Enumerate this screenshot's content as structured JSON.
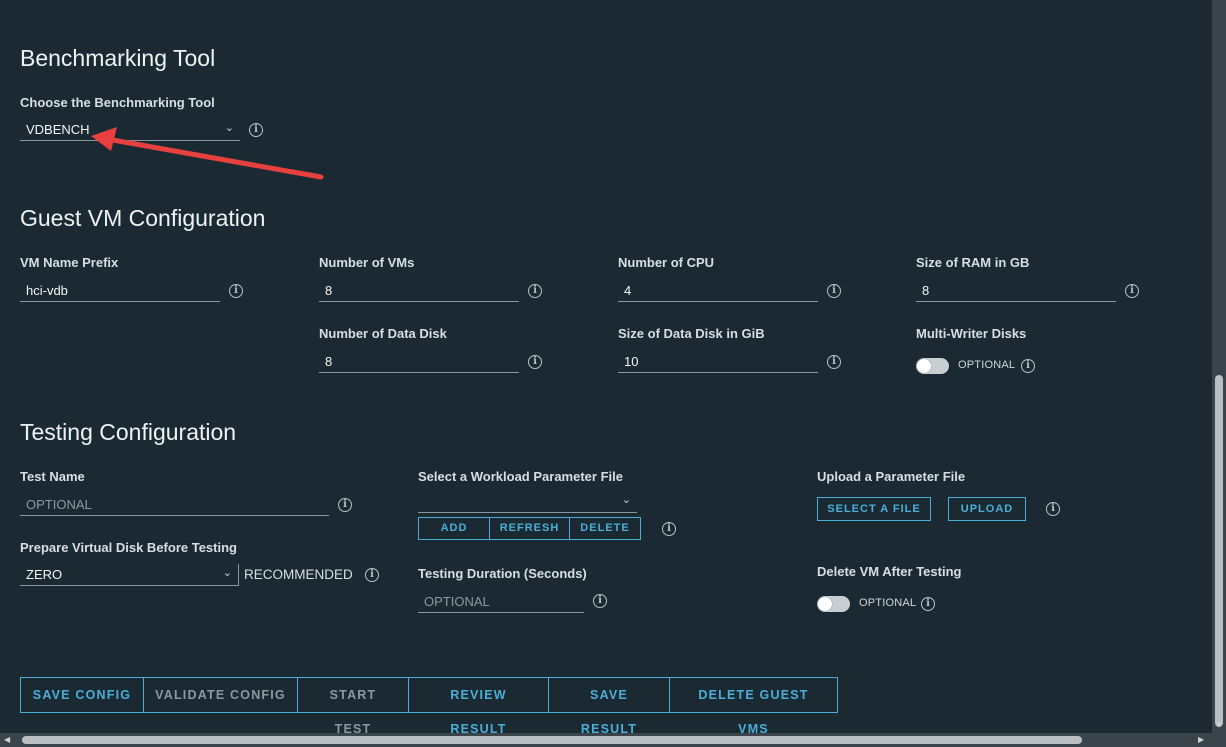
{
  "benchmark": {
    "heading": "Benchmarking Tool",
    "tool_label": "Choose the Benchmarking Tool",
    "tool_value": "VDBENCH"
  },
  "guest_vm": {
    "heading": "Guest VM Configuration",
    "vm_name_prefix_label": "VM Name Prefix",
    "vm_name_prefix_value": "hci-vdb",
    "num_vms_label": "Number of VMs",
    "num_vms_value": "8",
    "num_cpu_label": "Number of CPU",
    "num_cpu_value": "4",
    "ram_label": "Size of RAM in GB",
    "ram_value": "8",
    "num_data_disk_label": "Number of Data Disk",
    "num_data_disk_value": "8",
    "data_disk_size_label": "Size of Data Disk in GiB",
    "data_disk_size_value": "10",
    "multi_writer_label": "Multi-Writer Disks",
    "multi_writer_toggle_text": "OPTIONAL"
  },
  "testing": {
    "heading": "Testing Configuration",
    "test_name_label": "Test Name",
    "test_name_placeholder": "OPTIONAL",
    "workload_label": "Select a Workload Parameter File",
    "workload_value": "",
    "workload_buttons": [
      "ADD",
      "REFRESH",
      "DELETE"
    ],
    "upload_label": "Upload a Parameter File",
    "select_file_button": "SELECT A FILE",
    "upload_button": "UPLOAD",
    "prepare_disk_label": "Prepare Virtual Disk Before Testing",
    "prepare_disk_value": "ZERO",
    "prepare_disk_hint": "RECOMMENDED",
    "duration_label": "Testing Duration (Seconds)",
    "duration_placeholder": "OPTIONAL",
    "delete_vm_label": "Delete VM After Testing",
    "delete_vm_toggle_text": "OPTIONAL"
  },
  "actions": {
    "save_config": "SAVE CONFIG",
    "validate_config": "VALIDATE CONFIG",
    "start_test": "START TEST",
    "review_result": "REVIEW RESULT",
    "save_result": "SAVE RESULT",
    "delete_guest_vms": "DELETE GUEST VMS"
  },
  "colors": {
    "background": "#1b2a32",
    "accent": "#49afd9",
    "annotation_arrow": "#e8403f"
  },
  "icons": [
    "info-icon",
    "chevron-down-icon",
    "annotation-arrow"
  ]
}
